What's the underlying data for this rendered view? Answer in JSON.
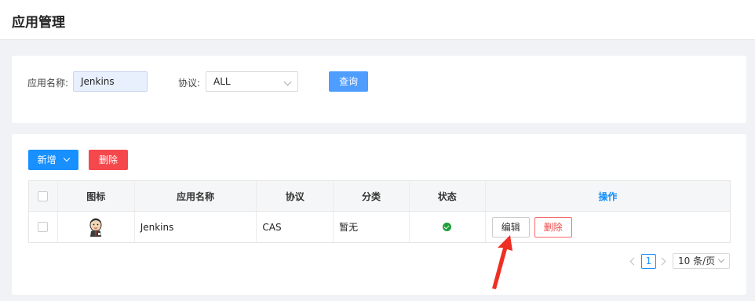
{
  "header": {
    "title": "应用管理"
  },
  "search": {
    "app_name_label": "应用名称:",
    "app_name_value": "Jenkins",
    "protocol_label": "协议:",
    "protocol_value": "ALL",
    "query_button": "查询"
  },
  "toolbar": {
    "add_button": "新增",
    "delete_button": "删除"
  },
  "table": {
    "columns": [
      "图标",
      "应用名称",
      "协议",
      "分类",
      "状态",
      "操作"
    ],
    "rows": [
      {
        "icon": "jenkins-logo-icon",
        "name": "Jenkins",
        "protocol": "CAS",
        "category": "暂无",
        "status": "enabled",
        "edit": "编辑",
        "delete": "删除"
      }
    ]
  },
  "pagination": {
    "current_page": "1",
    "page_size": "10 条/页"
  },
  "colors": {
    "primary": "#1890ff",
    "danger": "#f5484c",
    "status_ok": "#1e9e3c",
    "annotation_arrow": "#ee2f24"
  }
}
